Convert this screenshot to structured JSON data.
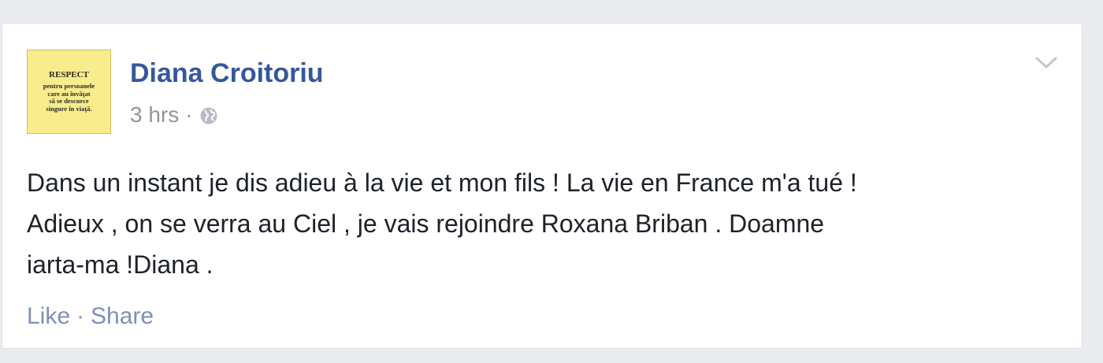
{
  "post": {
    "avatar": {
      "lines": [
        "RESPECT",
        "pentru persoanele",
        "care au învăţat",
        "să se descurce",
        "singure în viaţă."
      ]
    },
    "author_name": "Diana Croitoriu",
    "timestamp": "3 hrs",
    "separator": "·",
    "privacy_icon": "globe-icon",
    "menu_icon": "chevron-down-icon",
    "text_lines": [
      "Dans un instant je dis adieu à la vie et mon fils ! La vie en France m'a tué !",
      "Adieux , on se verra au Ciel , je vais rejoindre Roxana Briban . Doamne",
      "iarta-ma !Diana ."
    ],
    "actions": {
      "like_label": "Like",
      "separator": "·",
      "share_label": "Share"
    }
  },
  "colors": {
    "page_background": "#e9ebee",
    "card_background": "#ffffff",
    "author_link": "#365899",
    "meta_text": "#90949c",
    "body_text": "#1d2129",
    "action_link": "#7f8fb5",
    "avatar_background": "#f8ec8c"
  }
}
